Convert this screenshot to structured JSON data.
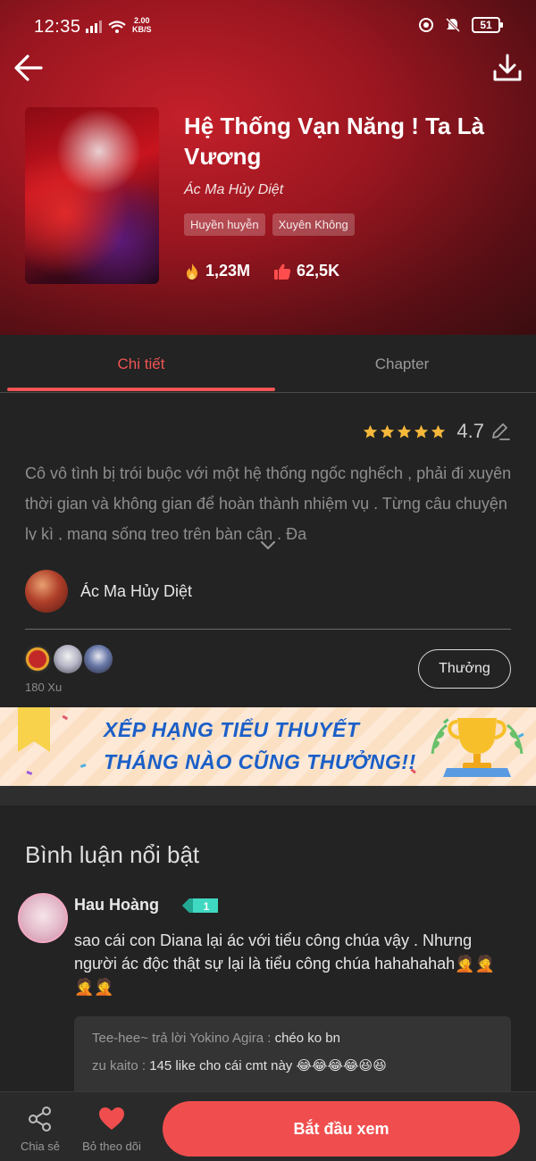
{
  "status_bar": {
    "time": "12:35",
    "speed_value": "2.00",
    "speed_unit": "KB/S",
    "battery": "51"
  },
  "book": {
    "title": "Hệ Thống Vạn Năng ! Ta Là Vương",
    "author": "Ác Ma Hủy Diệt",
    "tags": [
      "Huyền huyễn",
      "Xuyên Không"
    ],
    "views": "1,23M",
    "likes": "62,5K"
  },
  "tabs": {
    "detail": "Chi tiết",
    "chapter": "Chapter"
  },
  "rating": {
    "value": "4.7",
    "stars": 5
  },
  "description": "Cô vô tình bị trói buộc với một hệ thống ngốc nghếch , phải đi xuyên thời gian và không gian để hoàn thành nhiệm vụ . Từng câu chuyện ly kì , mạng sống treo trên bàn cân . Đa",
  "author_section": {
    "name": "Ác Ma Hủy Diệt"
  },
  "donations": {
    "amount": "180 Xu",
    "reward_label": "Thưởng"
  },
  "banner": {
    "line1": "XẾP HẠNG TIỂU THUYẾT",
    "line2": "THÁNG NÀO CŨNG THƯỞNG!!"
  },
  "comments": {
    "title": "Bình luận nổi bật",
    "items": [
      {
        "user": "Hau Hoàng",
        "badge": "1",
        "text": "sao cái con Diana lại ác với tiểu công chúa vậy . Nhưng người ác độc thật sự lại là tiểu công chúa hahahahah🤦🤦🤦🤦",
        "replies": [
          {
            "prefix": "Tee-hee~ trả lời Yokino Agira :",
            "text": "chéo ko bn"
          },
          {
            "prefix": "zu kaito :",
            "text": "145 like cho cái cmt này 😂😂😂😂😆😆"
          }
        ]
      }
    ]
  },
  "bottom_bar": {
    "share": "Chia sẻ",
    "unfollow": "Bỏ theo dõi",
    "start": "Bắt đầu xem"
  },
  "colors": {
    "accent": "#f04e4e",
    "hero": "#9a1620",
    "background": "#232323",
    "banner_text": "#1b5fc8"
  }
}
